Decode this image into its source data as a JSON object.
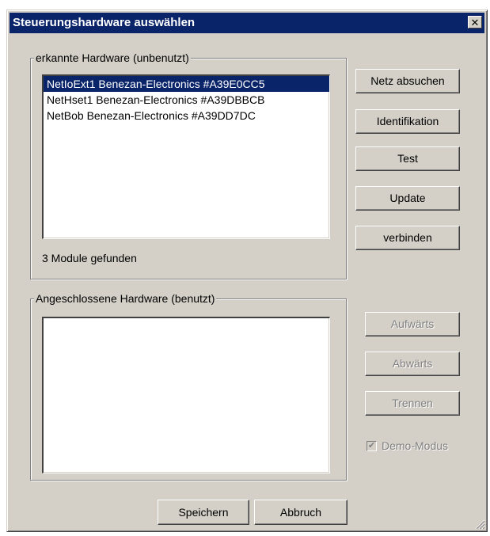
{
  "window": {
    "title": "Steuerungshardware auswählen",
    "close_symbol": "✕"
  },
  "detected": {
    "legend": "erkannte Hardware (unbenutzt)",
    "items": [
      {
        "label": "NetIoExt1 Benezan-Electronics #A39E0CC5",
        "selected": true
      },
      {
        "label": "NetHset1 Benezan-Electronics #A39DBBCB",
        "selected": false
      },
      {
        "label": "NetBob Benezan-Electronics #A39DD7DC",
        "selected": false
      }
    ],
    "status": "3 Module gefunden"
  },
  "connected": {
    "legend": "Angeschlossene Hardware (benutzt)",
    "items": []
  },
  "buttons": {
    "scan": "Netz absuchen",
    "identify": "Identifikation",
    "test": "Test",
    "update": "Update",
    "connect": "verbinden",
    "up": "Aufwärts",
    "down": "Abwärts",
    "disconnect": "Trennen",
    "save": "Speichern",
    "cancel": "Abbruch"
  },
  "demo_mode": {
    "label": "Demo-Modus",
    "checked": true,
    "enabled": false
  },
  "icons": {
    "close": "close-icon",
    "check": "checkmark-icon",
    "resize": "resize-grip-icon"
  }
}
